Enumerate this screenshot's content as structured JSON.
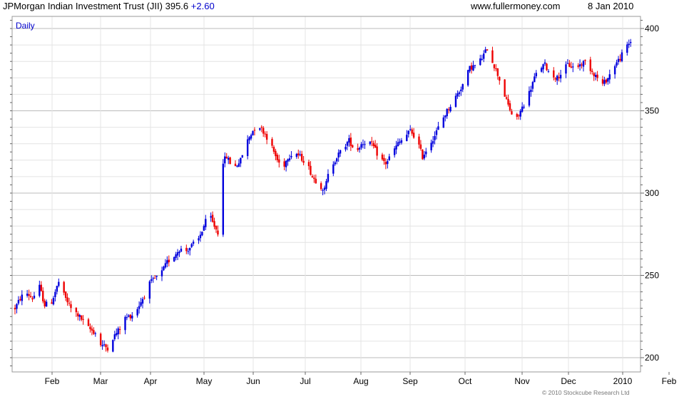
{
  "header": {
    "title": "JPMorgan Indian Investment Trust (JII)",
    "price": "395.6",
    "change": "+2.60",
    "website": "www.fullermoney.com",
    "date": "8 Jan 2010"
  },
  "footer": {
    "copyright": "© 2010 Stockcube Research Ltd"
  },
  "colors": {
    "up": "#0000dd",
    "down": "#ee0000",
    "grid": "#bbbbbb",
    "minor_grid": "#e4e4e4",
    "label": "#0000cc"
  },
  "chart_data": {
    "type": "candlestick",
    "period_label": "Daily",
    "ylim": [
      190,
      405
    ],
    "y_ticks": [
      200,
      250,
      300,
      350,
      400
    ],
    "x_ticks": [
      "Feb",
      "Mar",
      "Apr",
      "May",
      "Jun",
      "Jul",
      "Aug",
      "Sep",
      "Oct",
      "Nov",
      "Dec",
      "2010",
      "Feb"
    ],
    "anchors": [
      [
        0,
        230
      ],
      [
        3,
        236
      ],
      [
        6,
        240
      ],
      [
        10,
        236
      ],
      [
        14,
        243
      ],
      [
        17,
        232
      ],
      [
        21,
        234
      ],
      [
        25,
        246
      ],
      [
        28,
        238
      ],
      [
        32,
        230
      ],
      [
        36,
        226
      ],
      [
        39,
        222
      ],
      [
        42,
        218
      ],
      [
        46,
        215
      ],
      [
        49,
        208
      ],
      [
        53,
        206
      ],
      [
        56,
        212
      ],
      [
        60,
        218
      ],
      [
        63,
        224
      ],
      [
        67,
        226
      ],
      [
        70,
        230
      ],
      [
        74,
        238
      ],
      [
        77,
        245
      ],
      [
        80,
        248
      ],
      [
        84,
        252
      ],
      [
        87,
        258
      ],
      [
        91,
        262
      ],
      [
        94,
        266
      ],
      [
        98,
        265
      ],
      [
        101,
        268
      ],
      [
        105,
        272
      ],
      [
        108,
        280
      ],
      [
        111,
        288
      ],
      [
        113,
        282
      ],
      [
        116,
        276
      ],
      [
        117,
        268
      ],
      [
        118,
        318
      ],
      [
        121,
        322
      ],
      [
        125,
        315
      ],
      [
        129,
        320
      ],
      [
        132,
        330
      ],
      [
        136,
        338
      ],
      [
        139,
        342
      ],
      [
        143,
        336
      ],
      [
        146,
        330
      ],
      [
        150,
        320
      ],
      [
        153,
        315
      ],
      [
        156,
        322
      ],
      [
        160,
        325
      ],
      [
        163,
        322
      ],
      [
        167,
        318
      ],
      [
        170,
        310
      ],
      [
        174,
        305
      ],
      [
        177,
        302
      ],
      [
        180,
        315
      ],
      [
        184,
        322
      ],
      [
        188,
        328
      ],
      [
        191,
        332
      ],
      [
        195,
        325
      ],
      [
        198,
        330
      ],
      [
        202,
        332
      ],
      [
        205,
        328
      ],
      [
        208,
        322
      ],
      [
        212,
        318
      ],
      [
        216,
        325
      ],
      [
        219,
        330
      ],
      [
        223,
        334
      ],
      [
        226,
        338
      ],
      [
        230,
        332
      ],
      [
        233,
        322
      ],
      [
        236,
        328
      ],
      [
        240,
        335
      ],
      [
        243,
        342
      ],
      [
        247,
        350
      ],
      [
        250,
        355
      ],
      [
        254,
        362
      ],
      [
        257,
        368
      ],
      [
        260,
        376
      ],
      [
        264,
        378
      ],
      [
        267,
        382
      ],
      [
        270,
        388
      ],
      [
        273,
        380
      ],
      [
        276,
        372
      ],
      [
        278,
        366
      ],
      [
        281,
        356
      ],
      [
        284,
        348
      ],
      [
        287,
        345
      ],
      [
        290,
        352
      ],
      [
        293,
        358
      ],
      [
        297,
        370
      ],
      [
        300,
        376
      ],
      [
        303,
        378
      ],
      [
        306,
        372
      ],
      [
        310,
        370
      ],
      [
        313,
        374
      ],
      [
        316,
        378
      ],
      [
        320,
        376
      ],
      [
        323,
        378
      ],
      [
        326,
        380
      ],
      [
        330,
        374
      ],
      [
        333,
        370
      ],
      [
        336,
        366
      ],
      [
        339,
        370
      ],
      [
        343,
        378
      ],
      [
        346,
        382
      ],
      [
        349,
        388
      ],
      [
        352,
        392
      ],
      [
        355,
        395.6
      ]
    ],
    "volatility": 2.8,
    "total_days": 356,
    "last_day": 352
  }
}
